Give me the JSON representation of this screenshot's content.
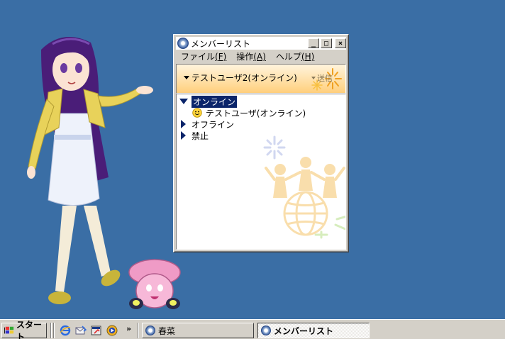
{
  "window": {
    "title": "メンバーリスト",
    "controls": {
      "minimize": "_",
      "maximize": "□",
      "close": "×"
    },
    "menu": [
      {
        "label": "ファイル",
        "accel": "(F)"
      },
      {
        "label": "操作",
        "accel": "(A)"
      },
      {
        "label": "ヘルプ",
        "accel": "(H)"
      }
    ],
    "status_selector": "テストユーザ2(オンライン)",
    "send_label": "送信",
    "groups": {
      "online": {
        "label": "オンライン",
        "members": [
          "テストユーザ(オンライン)"
        ]
      },
      "offline": {
        "label": "オフライン"
      },
      "blocked": {
        "label": "禁止"
      }
    }
  },
  "taskbar": {
    "start_label": "スタート",
    "quick_launch": [
      "ie-icon",
      "outlook-express-icon",
      "show-desktop-icon",
      "media-player-icon"
    ],
    "chevron": "»",
    "tasks": [
      {
        "label": "春菜",
        "active": false
      },
      {
        "label": "メンバーリスト",
        "active": true
      }
    ]
  },
  "colors": {
    "desktop": "#3a6ea5",
    "selection": "#0a246a",
    "status_panel": "#ffcf7c"
  }
}
